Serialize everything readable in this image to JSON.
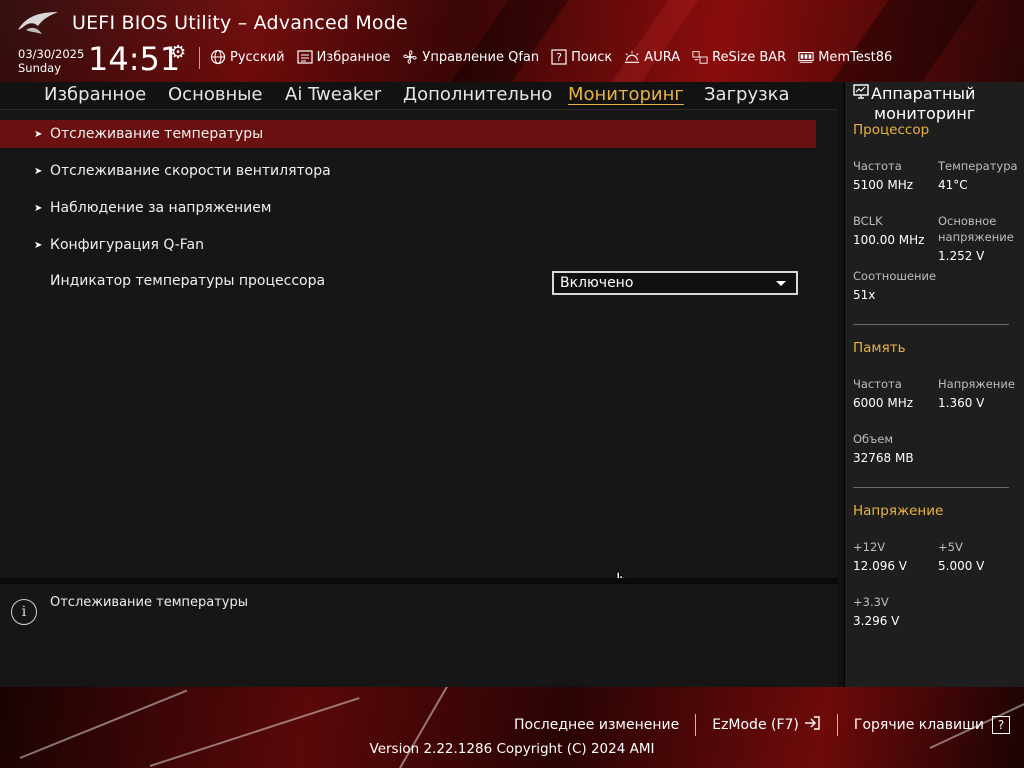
{
  "header": {
    "title": "UEFI BIOS Utility – Advanced Mode",
    "date": "03/30/2025",
    "day": "Sunday",
    "time": "14:51",
    "toolbar": [
      {
        "label": "Русский",
        "icon": "globe-icon"
      },
      {
        "label": "Избранное",
        "icon": "favorites-icon"
      },
      {
        "label": "Управление Qfan",
        "icon": "fan-icon"
      },
      {
        "label": "Поиск",
        "icon": "help-search-icon"
      },
      {
        "label": "AURA",
        "icon": "aura-icon"
      },
      {
        "label": "ReSize BAR",
        "icon": "resize-bar-icon"
      },
      {
        "label": "MemTest86",
        "icon": "memtest-icon"
      }
    ]
  },
  "tabs": [
    {
      "label": "Избранное"
    },
    {
      "label": "Основные"
    },
    {
      "label": "Ai Tweaker"
    },
    {
      "label": "Дополнительно"
    },
    {
      "label": "Мониторинг"
    },
    {
      "label": "Загрузка"
    }
  ],
  "active_tab": "Мониторинг",
  "menu": [
    {
      "label": "Отслеживание температуры",
      "submenu": true,
      "selected": true
    },
    {
      "label": "Отслеживание скорости вентилятора",
      "submenu": true
    },
    {
      "label": "Наблюдение за напряжением",
      "submenu": true
    },
    {
      "label": "Конфигурация Q-Fan",
      "submenu": true
    },
    {
      "label": "Индикатор температуры процессора",
      "submenu": false
    }
  ],
  "cpu_temp_indicator": {
    "value": "Включено"
  },
  "help": {
    "text": "Отслеживание температуры"
  },
  "monitor": {
    "title_line1": "Аппаратный",
    "title_line2": "мониторинг",
    "cpu": {
      "heading": "Процессор",
      "freq_label": "Частота",
      "freq": "5100 MHz",
      "temp_label": "Температура",
      "temp": "41°C",
      "bclk_label": "BCLK",
      "bclk": "100.00 MHz",
      "vcore_label_1": "Основное",
      "vcore_label_2": "напряжение",
      "vcore": "1.252 V",
      "ratio_label": "Соотношение",
      "ratio": "51x"
    },
    "memory": {
      "heading": "Память",
      "freq_label": "Частота",
      "freq": "6000 MHz",
      "volt_label": "Напряжение",
      "volt": "1.360 V",
      "size_label": "Объем",
      "size": "32768 MB"
    },
    "voltage": {
      "heading": "Напряжение",
      "v12_label": "+12V",
      "v12": "12.096 V",
      "v5_label": "+5V",
      "v5": "5.000 V",
      "v33_label": "+3.3V",
      "v33": "3.296 V"
    }
  },
  "footer": {
    "last_change": "Последнее изменение",
    "ezmode": "EzMode (F7)",
    "hotkeys": "Горячие клавиши",
    "hotkeys_key": "?",
    "version": "Version 2.22.1286 Copyright (C) 2024 AMI"
  },
  "colors": {
    "accent": "#e8b242",
    "selection": "#6a1010",
    "brand_red": "#8a0d0d"
  }
}
